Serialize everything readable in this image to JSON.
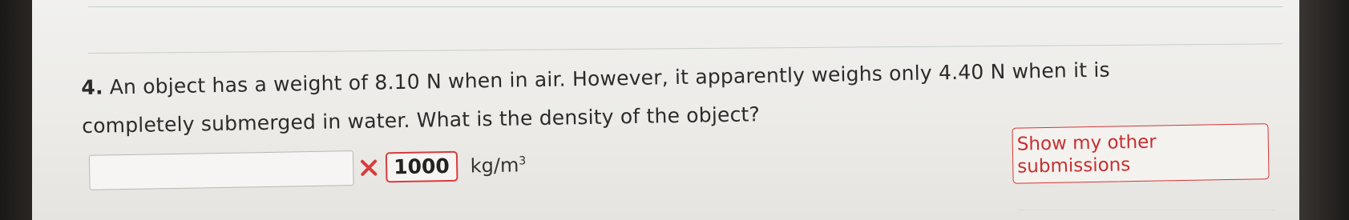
{
  "question": {
    "number": "4.",
    "text": "An object has a weight of 8.10 N when in air. However, it apparently weighs only 4.40 N when it is completely submerged in water. What is the density of the object?"
  },
  "answer": {
    "input_value": "",
    "submitted_value": "1000",
    "status": "incorrect",
    "unit_base": "kg/m",
    "unit_exponent": "3"
  },
  "buttons": {
    "show_other_submissions": "Show my other submissions"
  },
  "colors": {
    "error_red": "#d73c3c",
    "text": "#2c2b2a",
    "page_bg": "#eeedea"
  }
}
